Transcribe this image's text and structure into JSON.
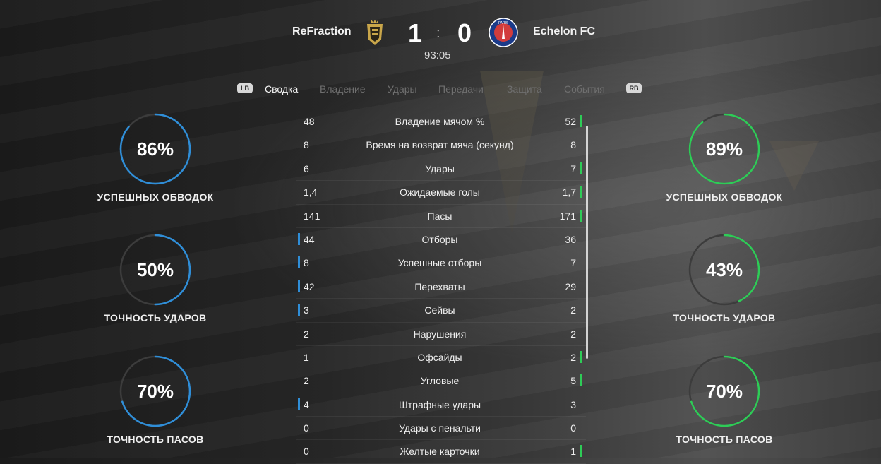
{
  "match": {
    "home_team": "ReFraction",
    "away_team": "Echelon FC",
    "home_score": "1",
    "away_score": "0",
    "separator": ":",
    "clock": "93:05",
    "away_crest_text": "PARIS"
  },
  "tabs": {
    "lb": "LB",
    "rb": "RB",
    "items": [
      "Сводка",
      "Владение",
      "Удары",
      "Передачи",
      "Защита",
      "События"
    ],
    "active_index": 0
  },
  "colors": {
    "home_accent": "#2f8ed8",
    "away_accent": "#2ecc57",
    "ring_track": "#3c3c3c"
  },
  "home_circles": [
    {
      "value": "86%",
      "label": "УСПЕШНЫХ ОБВОДОК",
      "fraction": 0.86
    },
    {
      "value": "50%",
      "label": "ТОЧНОСТЬ УДАРОВ",
      "fraction": 0.5
    },
    {
      "value": "70%",
      "label": "ТОЧНОСТЬ ПАСОВ",
      "fraction": 0.7
    }
  ],
  "away_circles": [
    {
      "value": "89%",
      "label": "УСПЕШНЫХ ОБВОДОК",
      "fraction": 0.89
    },
    {
      "value": "43%",
      "label": "ТОЧНОСТЬ УДАРОВ",
      "fraction": 0.43
    },
    {
      "value": "70%",
      "label": "ТОЧНОСТЬ ПАСОВ",
      "fraction": 0.7
    }
  ],
  "stats": [
    {
      "label": "Владение мячом %",
      "home": "48",
      "away": "52",
      "leader": "away"
    },
    {
      "label": "Время на возврат мяча (секунд)",
      "home": "8",
      "away": "8",
      "leader": "none"
    },
    {
      "label": "Удары",
      "home": "6",
      "away": "7",
      "leader": "away"
    },
    {
      "label": "Ожидаемые голы",
      "home": "1,4",
      "away": "1,7",
      "leader": "away"
    },
    {
      "label": "Пасы",
      "home": "141",
      "away": "171",
      "leader": "away"
    },
    {
      "label": "Отборы",
      "home": "44",
      "away": "36",
      "leader": "home"
    },
    {
      "label": "Успешные отборы",
      "home": "8",
      "away": "7",
      "leader": "home"
    },
    {
      "label": "Перехваты",
      "home": "42",
      "away": "29",
      "leader": "home"
    },
    {
      "label": "Сейвы",
      "home": "3",
      "away": "2",
      "leader": "home"
    },
    {
      "label": "Нарушения",
      "home": "2",
      "away": "2",
      "leader": "none"
    },
    {
      "label": "Офсайды",
      "home": "1",
      "away": "2",
      "leader": "away"
    },
    {
      "label": "Угловые",
      "home": "2",
      "away": "5",
      "leader": "away"
    },
    {
      "label": "Штрафные удары",
      "home": "4",
      "away": "3",
      "leader": "home"
    },
    {
      "label": "Удары с пенальти",
      "home": "0",
      "away": "0",
      "leader": "none"
    },
    {
      "label": "Желтые карточки",
      "home": "0",
      "away": "1",
      "leader": "away"
    }
  ]
}
